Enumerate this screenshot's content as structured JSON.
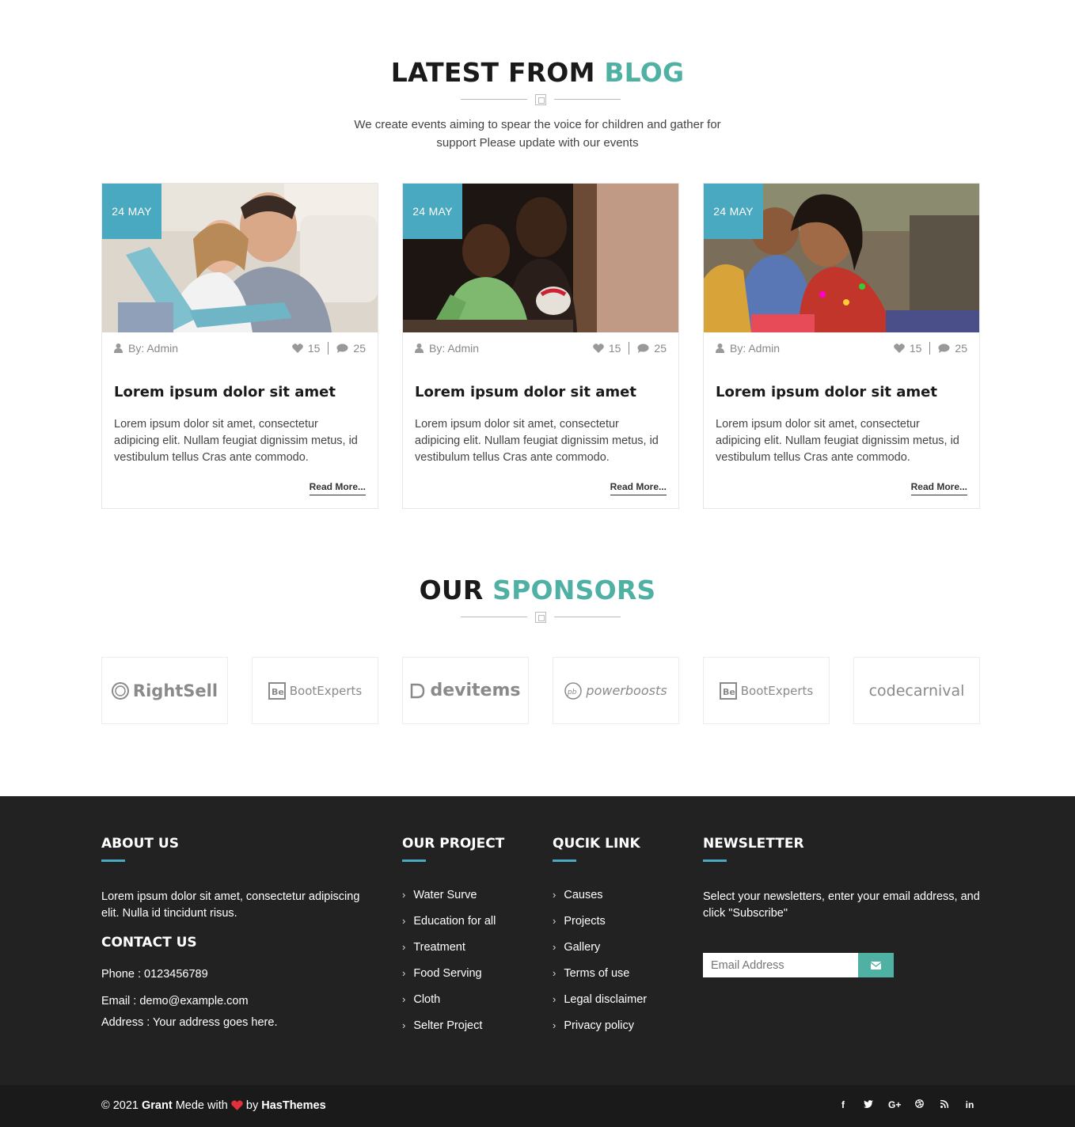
{
  "blog": {
    "title_main": "LATEST FROM",
    "title_accent": "BLOG",
    "intro": "We create events aiming to spear the voice for children and gather for support Please update with our events",
    "posts": [
      {
        "date": "24 MAY",
        "author": "By: Admin",
        "likes": "15",
        "comments": "25",
        "title": "Lorem ipsum dolor sit amet",
        "excerpt": "Lorem ipsum dolor sit amet, consectetur adipicing elit. Nullam feugiat dignissim metus, id vestibulum tellus Cras ante commodo.",
        "read_more": "Read More..."
      },
      {
        "date": "24 MAY",
        "author": "By: Admin",
        "likes": "15",
        "comments": "25",
        "title": "Lorem ipsum dolor sit amet",
        "excerpt": "Lorem ipsum dolor sit amet, consectetur adipicing elit. Nullam feugiat dignissim metus, id vestibulum tellus Cras ante commodo.",
        "read_more": "Read More..."
      },
      {
        "date": "24 MAY",
        "author": "By: Admin",
        "likes": "15",
        "comments": "25",
        "title": "Lorem ipsum dolor sit amet",
        "excerpt": "Lorem ipsum dolor sit amet, consectetur adipicing elit. Nullam feugiat dignissim metus, id vestibulum tellus Cras ante commodo.",
        "read_more": "Read More..."
      }
    ]
  },
  "sponsors": {
    "title_main": "OUR",
    "title_accent": "SPONSORS",
    "logos": [
      "RightSell",
      "BootExperts",
      "devitems",
      "powerboosts",
      "BootExperts",
      "codecarnival"
    ]
  },
  "footer": {
    "about": {
      "heading": "ABOUT US",
      "text": "Lorem ipsum dolor sit amet, consectetur adipiscing elit. Nulla id tincidunt risus."
    },
    "contact": {
      "heading": "CONTACT US",
      "phone": "Phone : 0123456789",
      "email": "Email : demo@example.com",
      "address": "Address : Your address goes here."
    },
    "project": {
      "heading": "OUR PROJECT",
      "items": [
        "Water Surve",
        "Education for all",
        "Treatment",
        "Food Serving",
        "Cloth",
        "Selter Project"
      ]
    },
    "quick": {
      "heading": "QUCIK LINK",
      "items": [
        "Causes",
        "Projects",
        "Gallery",
        "Terms of use",
        "Legal disclaimer",
        "Privacy policy"
      ]
    },
    "newsletter": {
      "heading": "NEWSLETTER",
      "text": "Select your newsletters, enter your email address, and click \"Subscribe\"",
      "placeholder": "Email Address"
    }
  },
  "bottom": {
    "copy_prefix": "© 2021",
    "brand": "Grant",
    "made_with": "Mede with",
    "by": "by",
    "company": "HasThemes",
    "social": [
      "f",
      "t",
      "G+",
      "dribbble",
      "rss",
      "in"
    ]
  },
  "colors": {
    "accent": "#4fb0a4",
    "date_badge": "#49a9c0",
    "footer_bg": "#222222",
    "bottom_bg": "#1a1a1a"
  }
}
